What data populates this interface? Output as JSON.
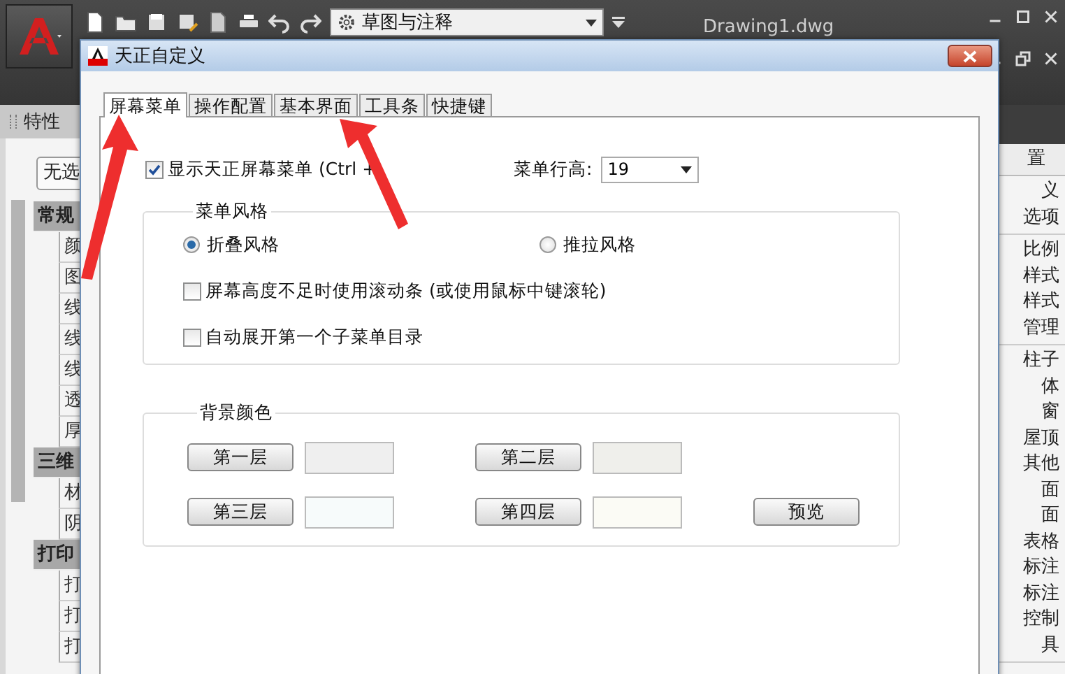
{
  "app": {
    "workspace": "草图与注释",
    "document_title": "Drawing1.dwg"
  },
  "properties_panel": {
    "title": "特性",
    "selection": "无选",
    "groups": [
      {
        "label": "常规",
        "rows": [
          "颜",
          "图",
          "线",
          "线",
          "线",
          "透",
          "厚"
        ]
      },
      {
        "label": "三维",
        "rows": [
          "材",
          "阴"
        ]
      },
      {
        "label": "打印",
        "rows": [
          "打",
          "打",
          "打"
        ]
      }
    ]
  },
  "right_panel": {
    "header": "置",
    "sections": [
      [
        "义",
        "选项"
      ],
      [
        "比例",
        "样式",
        "样式",
        "管理"
      ],
      [
        "柱子",
        "体",
        "窗",
        "屋顶",
        "其他",
        "面",
        "面",
        "表格",
        "标注",
        "标注",
        "控制",
        "具"
      ]
    ]
  },
  "dialog": {
    "title": "天正自定义",
    "tabs": [
      {
        "label": "屏幕菜单",
        "selected": true
      },
      {
        "label": "操作配置",
        "selected": false
      },
      {
        "label": "基本界面",
        "selected": false
      },
      {
        "label": "工具条",
        "selected": false
      },
      {
        "label": "快捷键",
        "selected": false
      }
    ],
    "show_menu": {
      "label": "显示天正屏幕菜单 (Ctrl +",
      "checked": true
    },
    "row_height": {
      "label": "菜单行高:",
      "value": "19"
    },
    "menu_style": {
      "title": "菜单风格",
      "options": [
        {
          "label": "折叠风格",
          "selected": true
        },
        {
          "label": "推拉风格",
          "selected": false
        }
      ],
      "checkboxes": [
        {
          "label": "屏幕高度不足时使用滚动条 (或使用鼠标中键滚轮)",
          "checked": false
        },
        {
          "label": "自动展开第一个子菜单目录",
          "checked": false
        }
      ]
    },
    "background": {
      "title": "背景颜色",
      "layers": [
        {
          "label": "第一层",
          "color": "#efefef"
        },
        {
          "label": "第二层",
          "color": "#efefeb"
        },
        {
          "label": "第三层",
          "color": "#f7fbfb"
        },
        {
          "label": "第四层",
          "color": "#fbfbf5"
        }
      ],
      "preview": "预览"
    }
  }
}
